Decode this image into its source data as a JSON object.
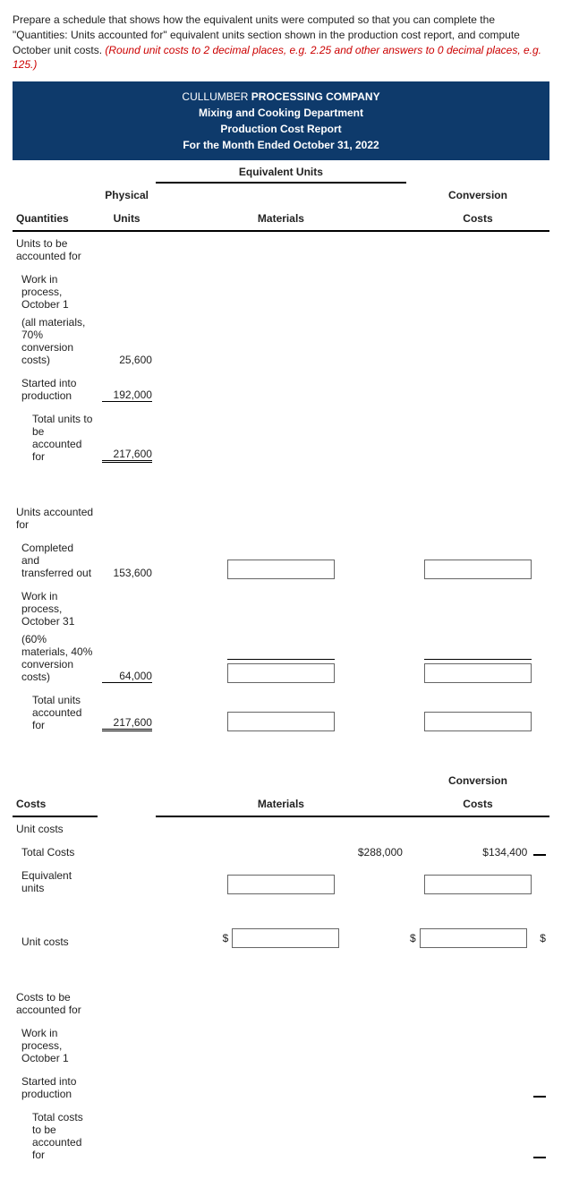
{
  "instructions": {
    "main": "Prepare a schedule that shows how the equivalent units were computed so that you can complete the \"Quantities: Units accounted for\" equivalent units section shown in the production cost report, and compute October unit costs.",
    "note": "(Round unit costs to 2 decimal places, e.g. 2.25 and other answers to 0 decimal places, e.g. 125.)"
  },
  "header": {
    "company": "CULLUMBER PROCESSING COMPANY",
    "company_pre": "CULLUMBER ",
    "company_bold": "PROCESSING COMPANY",
    "dept": "Mixing and Cooking Department",
    "report": "Production Cost Report",
    "period": "For the Month Ended October 31, 2022"
  },
  "cols": {
    "equiv": "Equivalent Units",
    "quantities": "Quantities",
    "phys": "Physical Units",
    "phys1": "Physical",
    "phys2": "Units",
    "materials": "Materials",
    "conv": "Conversion Costs",
    "conv1": "Conversion",
    "conv2": "Costs",
    "costs": "Costs"
  },
  "rows": {
    "units_to_be": "Units to be accounted for",
    "wip_oct1_a": "Work in process, October 1",
    "wip_oct1_b": "(all materials, 70% conversion costs)",
    "started": "Started into production",
    "total_to_be": "Total units to be accounted for",
    "units_acct": "Units accounted for",
    "completed": "Completed and transferred out",
    "wip_oct31_a": "Work in process, October 31",
    "wip_oct31_b": "(60% materials, 40% conversion costs)",
    "total_acct": "Total units accounted for",
    "unit_costs": "Unit costs",
    "total_costs": "Total Costs",
    "equiv_units": "Equivalent units",
    "unit_costs_row": "Unit costs",
    "costs_to_be": "Costs to be accounted for",
    "wip_oct1_c": "Work in process, October 1",
    "started_prod": "Started into production",
    "total_costs_to_be": "Total costs to be accounted for"
  },
  "values": {
    "wip_oct1": "25,600",
    "started": "192,000",
    "total_to_be": "217,600",
    "completed": "153,600",
    "wip_oct31": "64,000",
    "total_acct": "217,600",
    "total_costs_mat": "$288,000",
    "total_costs_conv": "$134,400",
    "dollar": "$"
  }
}
